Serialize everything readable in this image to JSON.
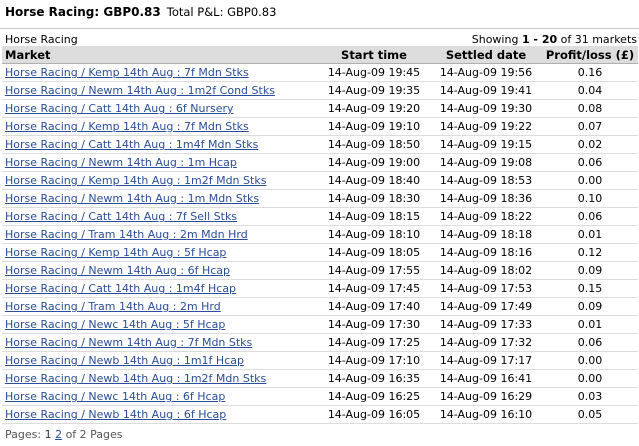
{
  "header": {
    "title": "Horse Racing: GBP0.83",
    "total_pl": "Total P&L: GBP0.83"
  },
  "section_label": "Horse Racing",
  "showing": {
    "prefix": "Showing",
    "range": "1 - 20",
    "suffix": "of 31 markets"
  },
  "table": {
    "columns": [
      "Market",
      "Start time",
      "Settled date",
      "Profit/loss (£)"
    ],
    "rows": [
      {
        "market": "Horse Racing / Kemp 14th Aug : 7f Mdn Stks",
        "start": "14-Aug-09 19:45",
        "settled": "14-Aug-09 19:56",
        "pl": "0.16"
      },
      {
        "market": "Horse Racing / Newm 14th Aug : 1m2f Cond Stks",
        "start": "14-Aug-09 19:35",
        "settled": "14-Aug-09 19:41",
        "pl": "0.04"
      },
      {
        "market": "Horse Racing / Catt 14th Aug : 6f Nursery",
        "start": "14-Aug-09 19:20",
        "settled": "14-Aug-09 19:30",
        "pl": "0.08"
      },
      {
        "market": "Horse Racing / Kemp 14th Aug : 7f Mdn Stks",
        "start": "14-Aug-09 19:10",
        "settled": "14-Aug-09 19:22",
        "pl": "0.07"
      },
      {
        "market": "Horse Racing / Catt 14th Aug : 1m4f Mdn Stks",
        "start": "14-Aug-09 18:50",
        "settled": "14-Aug-09 19:15",
        "pl": "0.02"
      },
      {
        "market": "Horse Racing / Newm 14th Aug : 1m Hcap",
        "start": "14-Aug-09 19:00",
        "settled": "14-Aug-09 19:08",
        "pl": "0.06"
      },
      {
        "market": "Horse Racing / Kemp 14th Aug : 1m2f Mdn Stks",
        "start": "14-Aug-09 18:40",
        "settled": "14-Aug-09 18:53",
        "pl": "0.00"
      },
      {
        "market": "Horse Racing / Newm 14th Aug : 1m Mdn Stks",
        "start": "14-Aug-09 18:30",
        "settled": "14-Aug-09 18:36",
        "pl": "0.10"
      },
      {
        "market": "Horse Racing / Catt 14th Aug : 7f Sell Stks",
        "start": "14-Aug-09 18:15",
        "settled": "14-Aug-09 18:22",
        "pl": "0.06"
      },
      {
        "market": "Horse Racing / Tram 14th Aug : 2m Mdn Hrd",
        "start": "14-Aug-09 18:10",
        "settled": "14-Aug-09 18:18",
        "pl": "0.01"
      },
      {
        "market": "Horse Racing / Kemp 14th Aug : 5f Hcap",
        "start": "14-Aug-09 18:05",
        "settled": "14-Aug-09 18:16",
        "pl": "0.12"
      },
      {
        "market": "Horse Racing / Newm 14th Aug : 6f Hcap",
        "start": "14-Aug-09 17:55",
        "settled": "14-Aug-09 18:02",
        "pl": "0.09"
      },
      {
        "market": "Horse Racing / Catt 14th Aug : 1m4f Hcap",
        "start": "14-Aug-09 17:45",
        "settled": "14-Aug-09 17:53",
        "pl": "0.15"
      },
      {
        "market": "Horse Racing / Tram 14th Aug : 2m Hrd",
        "start": "14-Aug-09 17:40",
        "settled": "14-Aug-09 17:49",
        "pl": "0.09"
      },
      {
        "market": "Horse Racing / Newc 14th Aug : 5f Hcap",
        "start": "14-Aug-09 17:30",
        "settled": "14-Aug-09 17:33",
        "pl": "0.01"
      },
      {
        "market": "Horse Racing / Newm 14th Aug : 7f Mdn Stks",
        "start": "14-Aug-09 17:25",
        "settled": "14-Aug-09 17:32",
        "pl": "0.06"
      },
      {
        "market": "Horse Racing / Newb 14th Aug : 1m1f Hcap",
        "start": "14-Aug-09 17:10",
        "settled": "14-Aug-09 17:17",
        "pl": "0.00"
      },
      {
        "market": "Horse Racing / Newb 14th Aug : 1m2f Mdn Stks",
        "start": "14-Aug-09 16:35",
        "settled": "14-Aug-09 16:41",
        "pl": "0.00"
      },
      {
        "market": "Horse Racing / Newc 14th Aug : 6f Hcap",
        "start": "14-Aug-09 16:25",
        "settled": "14-Aug-09 16:29",
        "pl": "0.03"
      },
      {
        "market": "Horse Racing / Newb 14th Aug : 6f Hcap",
        "start": "14-Aug-09 16:05",
        "settled": "14-Aug-09 16:10",
        "pl": "0.05"
      }
    ]
  },
  "pagination": {
    "label": "Pages:",
    "current": "1",
    "next": "2",
    "suffix": "of 2 Pages"
  },
  "colors": {
    "link": "#2a4e9a",
    "header_bg": "#dddddd"
  }
}
